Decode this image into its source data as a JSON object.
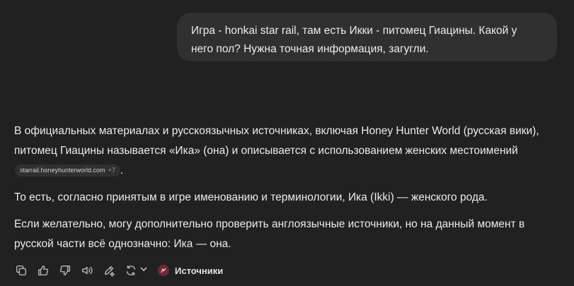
{
  "user_message": {
    "line1": "Игра - honkai star rail, там есть Икки - питомец Гиацины. Какой у",
    "line2": "него пол? Нужна точная информация, загугли."
  },
  "answer": {
    "p1_text": "В официальных материалах и русскоязычных источниках, включая Honey Hunter World (русская вики), питомец Гиацины называется «Ика» (она) и описывается с использованием женских местоимений",
    "citation_domain": "starrail.honeyhunterworld.com",
    "citation_more": "+7",
    "p1_end": ".",
    "p2": "То есть, согласно принятым в игре именованию и терминологии, Ика (Ikki) — женского рода.",
    "p3": "Если желательно, могу дополнительно проверить англоязычные источники, но на данный момент в русской части всё однозначно: Ика — она."
  },
  "toolbar": {
    "icons": [
      "copy-icon",
      "thumbs-up-icon",
      "thumbs-down-icon",
      "read-aloud-icon",
      "edit-icon",
      "regenerate-icon",
      "chevron-down-icon"
    ],
    "sources_label": "Источники",
    "sources_badge_color": "#6b2a36"
  }
}
